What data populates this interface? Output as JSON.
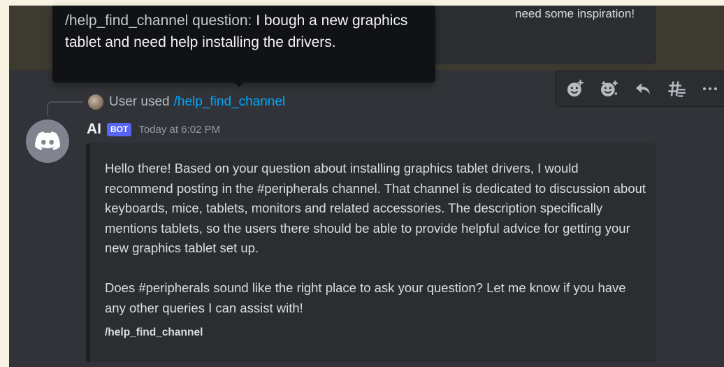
{
  "previous_message": {
    "visible_text": "need some inspiration!"
  },
  "tooltip": {
    "prefix": "/help_find_channel question:",
    "question": "I bough a new graphics tablet and need help installing the drivers."
  },
  "toolbar": {
    "buttons": [
      {
        "name": "add-reaction",
        "icon": "emoji-add-icon"
      },
      {
        "name": "super-reaction",
        "icon": "super-reaction-icon"
      },
      {
        "name": "reply",
        "icon": "reply-icon"
      },
      {
        "name": "create-thread",
        "icon": "thread-icon"
      },
      {
        "name": "more",
        "icon": "more-icon"
      }
    ]
  },
  "reply": {
    "user": "User used",
    "command": "/help_find_channel"
  },
  "message": {
    "author": "AI",
    "badge": "BOT",
    "timestamp": "Today at 6:02 PM",
    "avatar_icon": "discord-logo-icon",
    "embed": {
      "paragraph_1": "Hello there! Based on your question about installing graphics tablet drivers, I would recommend posting in the #peripherals channel. That channel is dedicated to discussion about keyboards, mice, tablets, monitors and related accessories. The description specifically mentions tablets, so the users there should be able to provide helpful advice for getting your new graphics tablet set up.",
      "paragraph_2": "Does #peripherals sound like the right place to ask your question? Let me know if you have any other queries I can assist with!",
      "footer": "/help_find_channel"
    }
  },
  "colors": {
    "background": "#313338",
    "embed_background": "#2b2d31",
    "tooltip_background": "#111214",
    "link": "#00a8fc",
    "bot_badge": "#5865f2"
  }
}
